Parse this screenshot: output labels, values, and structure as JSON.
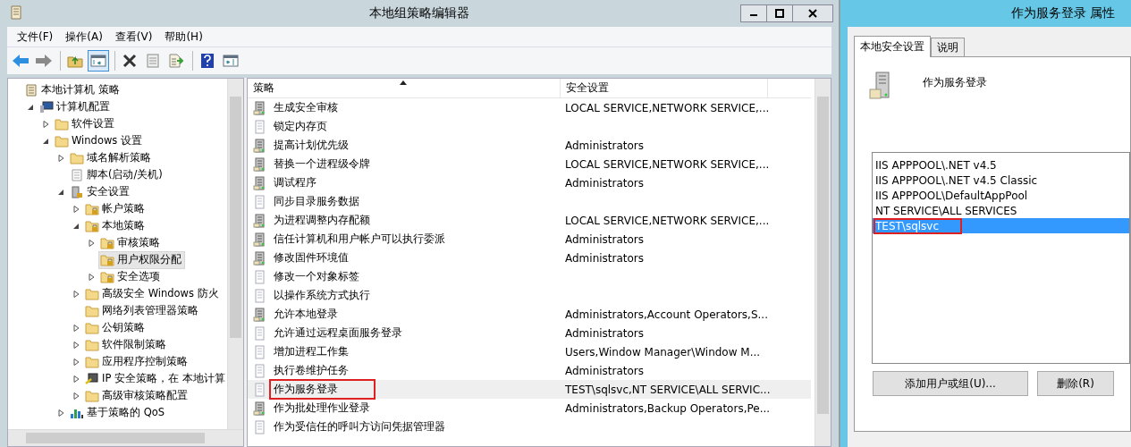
{
  "window": {
    "title": "本地组策略编辑器"
  },
  "menu": [
    "文件(F)",
    "操作(A)",
    "查看(V)",
    "帮助(H)"
  ],
  "toolbar": [
    {
      "kind": "back"
    },
    {
      "kind": "forward"
    },
    {
      "kind": "sep"
    },
    {
      "kind": "up"
    },
    {
      "kind": "tree",
      "selected": true
    },
    {
      "kind": "sep"
    },
    {
      "kind": "delete"
    },
    {
      "kind": "properties"
    },
    {
      "kind": "export"
    },
    {
      "kind": "sep"
    },
    {
      "kind": "help"
    },
    {
      "kind": "pane"
    }
  ],
  "tree": [
    {
      "label": "本地计算机 策略",
      "kind": "scroll",
      "selected": false,
      "children": [
        {
          "label": "计算机配置",
          "kind": "computer",
          "expanded": true,
          "selected": false,
          "children": [
            {
              "label": "软件设置",
              "kind": "folder",
              "expanded": false,
              "selected": false
            },
            {
              "label": "Windows 设置",
              "kind": "folder",
              "expanded": true,
              "selected": false,
              "children": [
                {
                  "label": "域名解析策略",
                  "kind": "folder",
                  "expanded": false,
                  "selected": false
                },
                {
                  "label": "脚本(启动/关机)",
                  "kind": "script",
                  "selected": false
                },
                {
                  "label": "安全设置",
                  "kind": "server",
                  "expanded": true,
                  "selected": false,
                  "children": [
                    {
                      "label": "帐户策略",
                      "kind": "lock-folder",
                      "expanded": false,
                      "selected": false
                    },
                    {
                      "label": "本地策略",
                      "kind": "lock-folder",
                      "expanded": true,
                      "selected": false,
                      "children": [
                        {
                          "label": "审核策略",
                          "kind": "lock-folder",
                          "expanded": false,
                          "selected": false
                        },
                        {
                          "label": "用户权限分配",
                          "kind": "lock-folder",
                          "selected": true
                        },
                        {
                          "label": "安全选项",
                          "kind": "lock-folder",
                          "expanded": false,
                          "selected": false
                        }
                      ]
                    },
                    {
                      "label": "高级安全 Windows 防火",
                      "kind": "folder",
                      "expanded": false,
                      "selected": false
                    },
                    {
                      "label": "网络列表管理器策略",
                      "kind": "folder",
                      "selected": false
                    },
                    {
                      "label": "公钥策略",
                      "kind": "folder",
                      "expanded": false,
                      "selected": false
                    },
                    {
                      "label": "软件限制策略",
                      "kind": "folder",
                      "expanded": false,
                      "selected": false
                    },
                    {
                      "label": "应用程序控制策略",
                      "kind": "folder",
                      "expanded": false,
                      "selected": false
                    },
                    {
                      "label": "IP 安全策略，在 本地计算",
                      "kind": "ip",
                      "expanded": false,
                      "selected": false
                    },
                    {
                      "label": "高级审核策略配置",
                      "kind": "folder",
                      "expanded": false,
                      "selected": false
                    }
                  ]
                },
                {
                  "label": "基于策略的 QoS",
                  "kind": "chart",
                  "expanded": false,
                  "selected": false
                }
              ]
            }
          ]
        }
      ]
    }
  ],
  "table": {
    "columns": [
      {
        "label": "策略",
        "sorted": true
      },
      {
        "label": "安全设置",
        "sorted": false
      }
    ],
    "rows": [
      {
        "policy": "生成安全审核",
        "setting": "LOCAL SERVICE,NETWORK SERVICE,...",
        "kind": "server",
        "selected": false,
        "highlighted": false
      },
      {
        "policy": "锁定内存页",
        "kind": "page",
        "selected": false,
        "highlighted": false
      },
      {
        "policy": "提高计划优先级",
        "setting": "Administrators",
        "kind": "server",
        "selected": false,
        "highlighted": false
      },
      {
        "policy": "替换一个进程级令牌",
        "setting": "LOCAL SERVICE,NETWORK SERVICE,...",
        "kind": "server",
        "selected": false,
        "highlighted": false
      },
      {
        "policy": "调试程序",
        "setting": "Administrators",
        "kind": "server",
        "selected": false,
        "highlighted": false
      },
      {
        "policy": "同步目录服务数据",
        "kind": "page",
        "selected": false,
        "highlighted": false
      },
      {
        "policy": "为进程调整内存配额",
        "setting": "LOCAL SERVICE,NETWORK SERVICE,...",
        "kind": "server",
        "selected": false,
        "highlighted": false
      },
      {
        "policy": "信任计算机和用户帐户可以执行委派",
        "setting": "Administrators",
        "kind": "server",
        "selected": false,
        "highlighted": false
      },
      {
        "policy": "修改固件环境值",
        "setting": "Administrators",
        "kind": "server",
        "selected": false,
        "highlighted": false
      },
      {
        "policy": "修改一个对象标签",
        "kind": "page",
        "selected": false,
        "highlighted": false
      },
      {
        "policy": "以操作系统方式执行",
        "kind": "page",
        "selected": false,
        "highlighted": false
      },
      {
        "policy": "允许本地登录",
        "setting": "Administrators,Account Operators,S...",
        "kind": "server",
        "selected": false,
        "highlighted": false
      },
      {
        "policy": "允许通过远程桌面服务登录",
        "setting": "Administrators",
        "kind": "page",
        "selected": false,
        "highlighted": false
      },
      {
        "policy": "增加进程工作集",
        "setting": "Users,Window Manager\\Window M...",
        "kind": "page",
        "selected": false,
        "highlighted": false
      },
      {
        "policy": "执行卷维护任务",
        "setting": "Administrators",
        "kind": "page",
        "selected": false,
        "highlighted": false
      },
      {
        "policy": "作为服务登录",
        "setting": "TEST\\sqlsvc,NT SERVICE\\ALL SERVIC...",
        "kind": "page",
        "selected": true,
        "highlighted": true
      },
      {
        "policy": "作为批处理作业登录",
        "setting": "Administrators,Backup Operators,Pe...",
        "kind": "server",
        "selected": false,
        "highlighted": false
      },
      {
        "policy": "作为受信任的呼叫方访问凭据管理器",
        "kind": "page",
        "selected": false,
        "highlighted": false
      }
    ]
  },
  "dialog": {
    "title": "作为服务登录 属性",
    "tabs": [
      {
        "label": "本地安全设置",
        "selected": true
      },
      {
        "label": "说明",
        "selected": false
      }
    ],
    "policy_name": "作为服务登录",
    "members": [
      {
        "name": "IIS APPPOOL\\.NET v4.5",
        "selected": false,
        "highlighted": false
      },
      {
        "name": "IIS APPPOOL\\.NET v4.5 Classic",
        "selected": false,
        "highlighted": false
      },
      {
        "name": "IIS APPPOOL\\DefaultAppPool",
        "selected": false,
        "highlighted": false
      },
      {
        "name": "NT SERVICE\\ALL SERVICES",
        "selected": false,
        "highlighted": false
      },
      {
        "name": "TEST\\sqlsvc",
        "selected": true,
        "highlighted": true
      }
    ],
    "buttons": [
      "添加用户或组(U)...",
      "删除(R)"
    ]
  }
}
